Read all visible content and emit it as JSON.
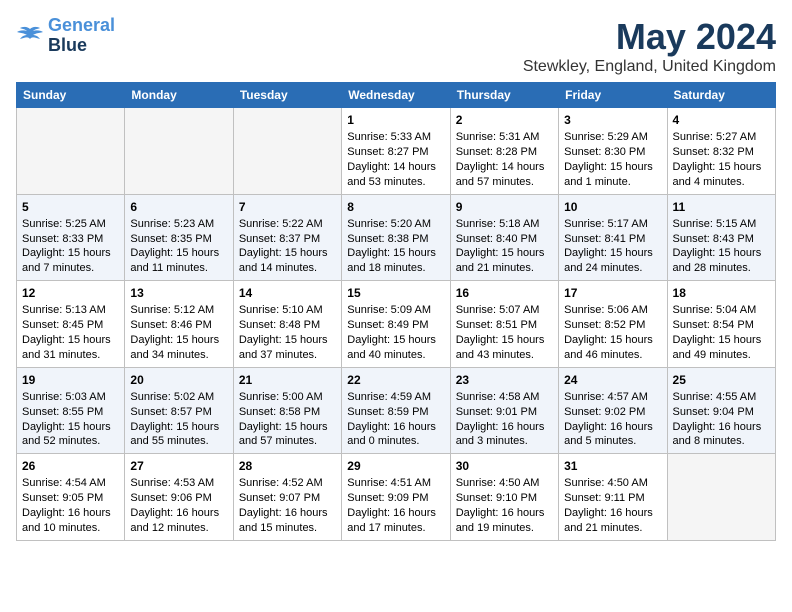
{
  "header": {
    "logo_line1": "General",
    "logo_line2": "Blue",
    "month": "May 2024",
    "location": "Stewkley, England, United Kingdom"
  },
  "weekdays": [
    "Sunday",
    "Monday",
    "Tuesday",
    "Wednesday",
    "Thursday",
    "Friday",
    "Saturday"
  ],
  "weeks": [
    [
      {
        "day": "",
        "info": ""
      },
      {
        "day": "",
        "info": ""
      },
      {
        "day": "",
        "info": ""
      },
      {
        "day": "1",
        "info": "Sunrise: 5:33 AM\nSunset: 8:27 PM\nDaylight: 14 hours and 53 minutes."
      },
      {
        "day": "2",
        "info": "Sunrise: 5:31 AM\nSunset: 8:28 PM\nDaylight: 14 hours and 57 minutes."
      },
      {
        "day": "3",
        "info": "Sunrise: 5:29 AM\nSunset: 8:30 PM\nDaylight: 15 hours and 1 minute."
      },
      {
        "day": "4",
        "info": "Sunrise: 5:27 AM\nSunset: 8:32 PM\nDaylight: 15 hours and 4 minutes."
      }
    ],
    [
      {
        "day": "5",
        "info": "Sunrise: 5:25 AM\nSunset: 8:33 PM\nDaylight: 15 hours and 7 minutes."
      },
      {
        "day": "6",
        "info": "Sunrise: 5:23 AM\nSunset: 8:35 PM\nDaylight: 15 hours and 11 minutes."
      },
      {
        "day": "7",
        "info": "Sunrise: 5:22 AM\nSunset: 8:37 PM\nDaylight: 15 hours and 14 minutes."
      },
      {
        "day": "8",
        "info": "Sunrise: 5:20 AM\nSunset: 8:38 PM\nDaylight: 15 hours and 18 minutes."
      },
      {
        "day": "9",
        "info": "Sunrise: 5:18 AM\nSunset: 8:40 PM\nDaylight: 15 hours and 21 minutes."
      },
      {
        "day": "10",
        "info": "Sunrise: 5:17 AM\nSunset: 8:41 PM\nDaylight: 15 hours and 24 minutes."
      },
      {
        "day": "11",
        "info": "Sunrise: 5:15 AM\nSunset: 8:43 PM\nDaylight: 15 hours and 28 minutes."
      }
    ],
    [
      {
        "day": "12",
        "info": "Sunrise: 5:13 AM\nSunset: 8:45 PM\nDaylight: 15 hours and 31 minutes."
      },
      {
        "day": "13",
        "info": "Sunrise: 5:12 AM\nSunset: 8:46 PM\nDaylight: 15 hours and 34 minutes."
      },
      {
        "day": "14",
        "info": "Sunrise: 5:10 AM\nSunset: 8:48 PM\nDaylight: 15 hours and 37 minutes."
      },
      {
        "day": "15",
        "info": "Sunrise: 5:09 AM\nSunset: 8:49 PM\nDaylight: 15 hours and 40 minutes."
      },
      {
        "day": "16",
        "info": "Sunrise: 5:07 AM\nSunset: 8:51 PM\nDaylight: 15 hours and 43 minutes."
      },
      {
        "day": "17",
        "info": "Sunrise: 5:06 AM\nSunset: 8:52 PM\nDaylight: 15 hours and 46 minutes."
      },
      {
        "day": "18",
        "info": "Sunrise: 5:04 AM\nSunset: 8:54 PM\nDaylight: 15 hours and 49 minutes."
      }
    ],
    [
      {
        "day": "19",
        "info": "Sunrise: 5:03 AM\nSunset: 8:55 PM\nDaylight: 15 hours and 52 minutes."
      },
      {
        "day": "20",
        "info": "Sunrise: 5:02 AM\nSunset: 8:57 PM\nDaylight: 15 hours and 55 minutes."
      },
      {
        "day": "21",
        "info": "Sunrise: 5:00 AM\nSunset: 8:58 PM\nDaylight: 15 hours and 57 minutes."
      },
      {
        "day": "22",
        "info": "Sunrise: 4:59 AM\nSunset: 8:59 PM\nDaylight: 16 hours and 0 minutes."
      },
      {
        "day": "23",
        "info": "Sunrise: 4:58 AM\nSunset: 9:01 PM\nDaylight: 16 hours and 3 minutes."
      },
      {
        "day": "24",
        "info": "Sunrise: 4:57 AM\nSunset: 9:02 PM\nDaylight: 16 hours and 5 minutes."
      },
      {
        "day": "25",
        "info": "Sunrise: 4:55 AM\nSunset: 9:04 PM\nDaylight: 16 hours and 8 minutes."
      }
    ],
    [
      {
        "day": "26",
        "info": "Sunrise: 4:54 AM\nSunset: 9:05 PM\nDaylight: 16 hours and 10 minutes."
      },
      {
        "day": "27",
        "info": "Sunrise: 4:53 AM\nSunset: 9:06 PM\nDaylight: 16 hours and 12 minutes."
      },
      {
        "day": "28",
        "info": "Sunrise: 4:52 AM\nSunset: 9:07 PM\nDaylight: 16 hours and 15 minutes."
      },
      {
        "day": "29",
        "info": "Sunrise: 4:51 AM\nSunset: 9:09 PM\nDaylight: 16 hours and 17 minutes."
      },
      {
        "day": "30",
        "info": "Sunrise: 4:50 AM\nSunset: 9:10 PM\nDaylight: 16 hours and 19 minutes."
      },
      {
        "day": "31",
        "info": "Sunrise: 4:50 AM\nSunset: 9:11 PM\nDaylight: 16 hours and 21 minutes."
      },
      {
        "day": "",
        "info": ""
      }
    ]
  ]
}
